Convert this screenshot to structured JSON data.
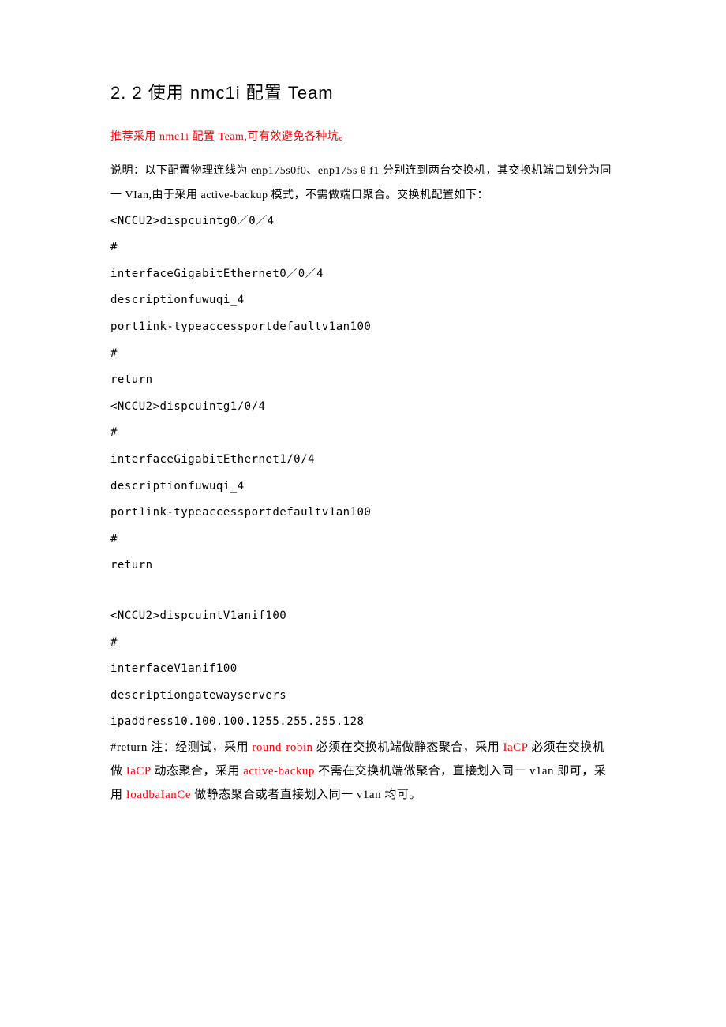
{
  "heading": "2. 2 使用 nmc1i 配置 Team",
  "redline": "推荐采用 nmc1i 配置 Team,可有效避免各种坑。",
  "para1": "说明：以下配置物理连线为 enp175s0f0、enp175s θ f1 分别连到两台交换机，其交换机端口划分为同一 VIan,由于采用 active-backup 模式，不需做端口聚合。交换机配置如下：",
  "cfg": {
    "l1": "<NCCU2>dispcuintg0／0／4",
    "l2": "#",
    "l3": "interfaceGigabitEthernet0／0／4",
    "l4": "descriptionfuwuqi_4",
    "l5": "port1ink-typeaccessportdefaultv1an100",
    "l6": "#",
    "l7": "return",
    "l8": "<NCCU2>dispcuintg1/0/4",
    "l9": "#",
    "l10": "interfaceGigabitEthernet1/0/4",
    "l11": "descriptionfuwuqi_4",
    "l12": "port1ink-typeaccessportdefaultv1an100",
    "l13": "#",
    "l14": "return",
    "l15": "<NCCU2>dispcuintV1anif100",
    "l16": "#",
    "l17": "interfaceV1anif100",
    "l18": "descriptiongatewayservers",
    "l19": "ipaddress10.100.100.1255.255.255.128"
  },
  "note": {
    "p1": "#return 注：经测试，采用 ",
    "r1": "round-robin",
    "p2": " 必须在交换机端做静态聚合，采用 ",
    "r2": "IaCP",
    "p3": " 必须在交换机做 ",
    "r3": "IaCP",
    "p4": " 动态聚合，采用 ",
    "r4": "active-backup",
    "p5": " 不需在交换机端做聚合，直接划入同一 v1an 即可，采用 ",
    "r5": "IoadbaIanCe",
    "p6": " 做静态聚合或者直接划入同一 v1an 均可。"
  }
}
